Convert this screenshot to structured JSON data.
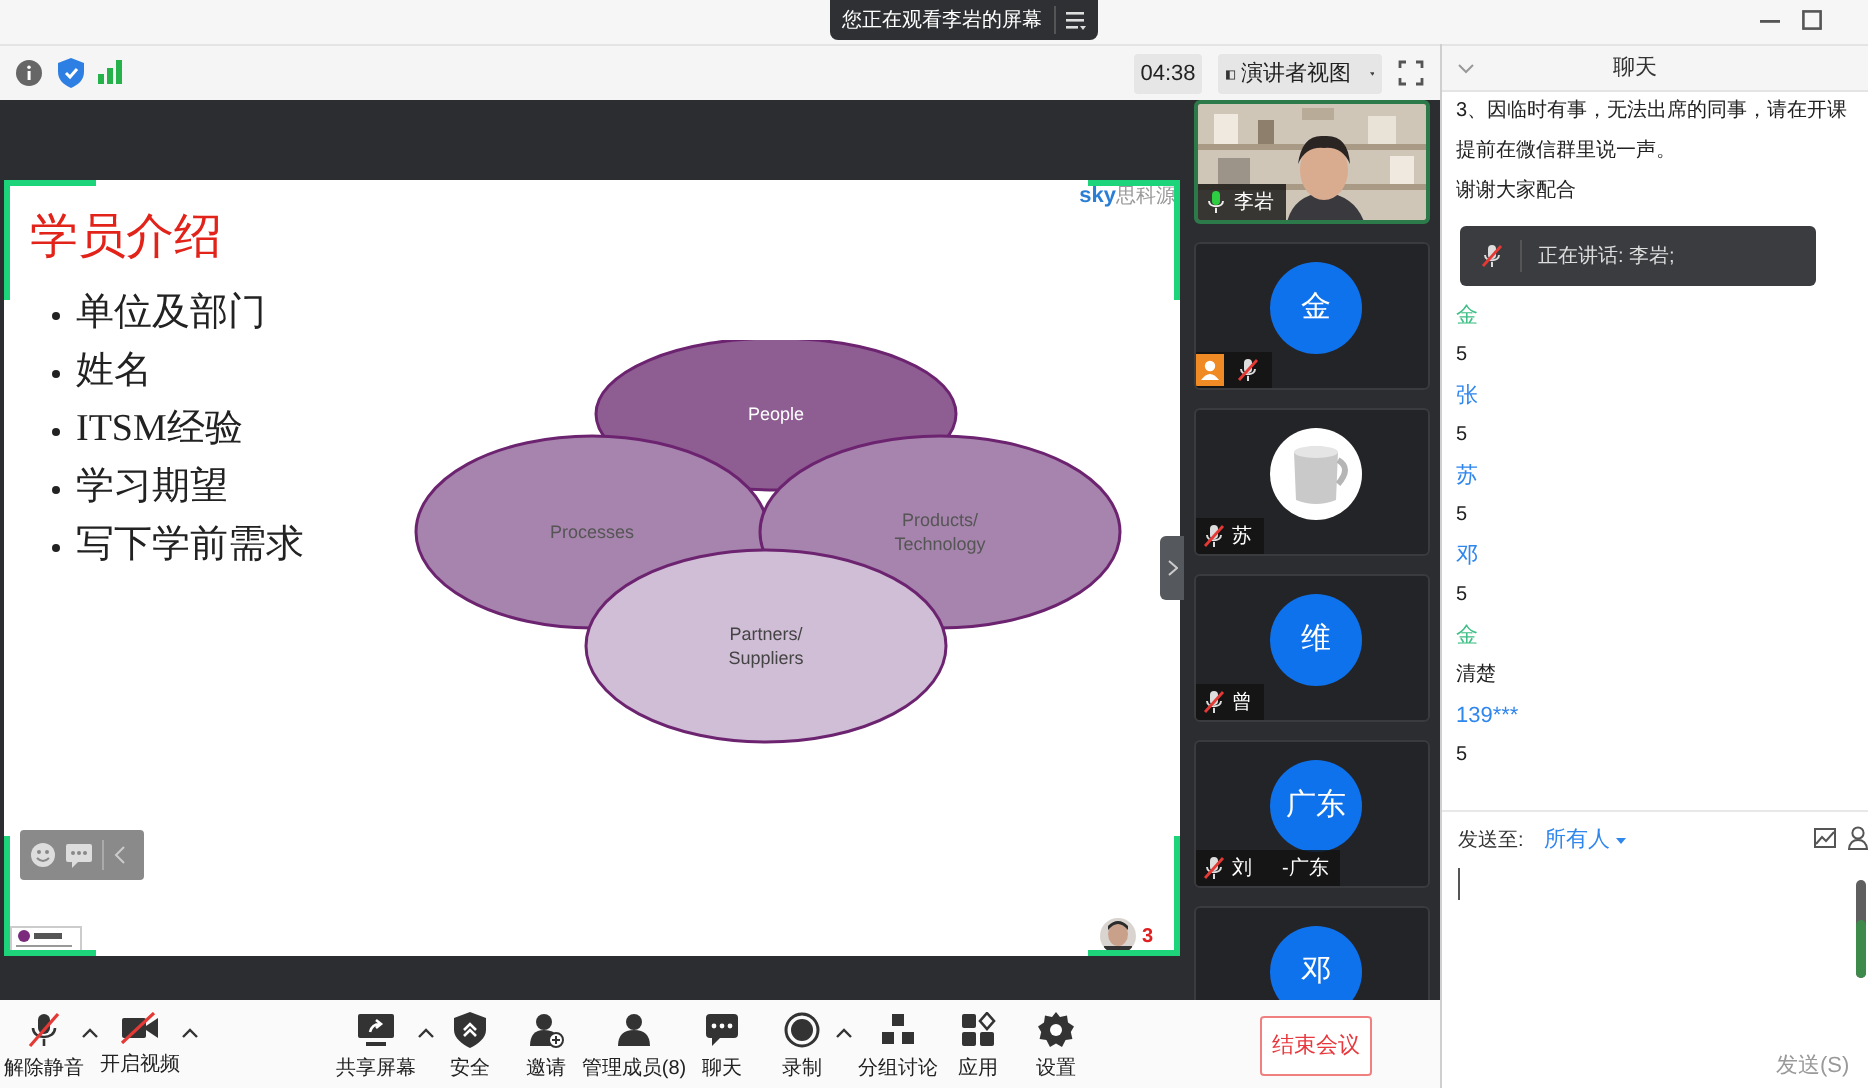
{
  "share_banner": {
    "text": "您正在观看李岩的屏幕"
  },
  "meeting_bar": {
    "timer": "04:38",
    "view_button": "演讲者视图"
  },
  "slide": {
    "title": "学员介绍",
    "bullets": [
      "单位及部门",
      "姓名",
      "ITSM经验",
      "学习期望",
      "写下学前需求"
    ],
    "logo": {
      "brand": "sky",
      "name": "思科源"
    },
    "diagram": [
      {
        "lines": [
          "People"
        ],
        "color": "#8e5d92"
      },
      {
        "lines": [
          "Processes"
        ],
        "color": "#a784ad"
      },
      {
        "lines": [
          "Products/",
          "Technology"
        ],
        "color": "#a784ad"
      },
      {
        "lines": [
          "Partners/",
          "Suppliers"
        ],
        "color": "#d0bdd6"
      }
    ],
    "viewer_count": "3"
  },
  "participants": [
    {
      "kind": "video",
      "muted": false,
      "host": false,
      "active": true,
      "name_parts": [
        "李岩"
      ]
    },
    {
      "kind": "avatar",
      "avatar_text": "金",
      "muted": true,
      "host": true,
      "active": false
    },
    {
      "muted": true,
      "host": false,
      "active": false,
      "name_parts": [
        "苏"
      ]
    },
    {
      "kind": "avatar",
      "avatar_text": "维",
      "muted": true,
      "host": false,
      "active": false,
      "name_parts": [
        "曾"
      ]
    },
    {
      "kind": "avatar",
      "avatar_text": "广东",
      "muted": true,
      "host": false,
      "active": false,
      "name_parts": [
        "刘",
        "-广东"
      ]
    },
    {
      "kind": "avatar",
      "avatar_text": "邓",
      "active": false
    }
  ],
  "chat": {
    "title": "聊天",
    "messages": [
      {
        "kind": "text",
        "text": "3、因临时有事，无法出席的同事，请在开课"
      },
      {
        "kind": "text",
        "text": "提前在微信群里说一声。"
      },
      {
        "kind": "text",
        "text": "谢谢大家配合"
      },
      {
        "kind": "toast",
        "text": "正在讲话: 李岩;"
      },
      {
        "kind": "sender",
        "text": "金",
        "color": "#3dbf85"
      },
      {
        "kind": "text",
        "text": "5"
      },
      {
        "kind": "sender",
        "text": "张",
        "color": "#2f86ec"
      },
      {
        "kind": "text",
        "text": "5"
      },
      {
        "kind": "sender",
        "text": "苏",
        "color": "#2f86ec"
      },
      {
        "kind": "text",
        "text": "5"
      },
      {
        "kind": "sender",
        "text": "邓",
        "color": "#2f86ec"
      },
      {
        "kind": "text",
        "text": "5"
      },
      {
        "kind": "sender",
        "text": "金",
        "color": "#3dbf85"
      },
      {
        "kind": "text",
        "text": "清楚"
      },
      {
        "kind": "sender",
        "text": "139***",
        "color": "#2f86ec"
      },
      {
        "kind": "text",
        "text": "5"
      }
    ],
    "send_to_label": "发送至:",
    "recipient": "所有人",
    "send_button": "发送(S)"
  },
  "toolbar": {
    "items": [
      {
        "label": "解除静音",
        "has_menu": true
      },
      {
        "label": "开启视频",
        "has_menu": true
      },
      {
        "label": "共享屏幕",
        "has_menu": true
      },
      {
        "label": "安全",
        "has_menu": false
      },
      {
        "label": "邀请",
        "has_menu": false
      },
      {
        "label": "管理成员(8)",
        "has_menu": false
      },
      {
        "label": "聊天",
        "has_menu": false
      },
      {
        "label": "录制",
        "has_menu": true
      },
      {
        "label": "分组讨论",
        "has_menu": false
      },
      {
        "label": "应用",
        "has_menu": false
      },
      {
        "label": "设置",
        "has_menu": false
      }
    ],
    "end_button": "结束会议"
  }
}
